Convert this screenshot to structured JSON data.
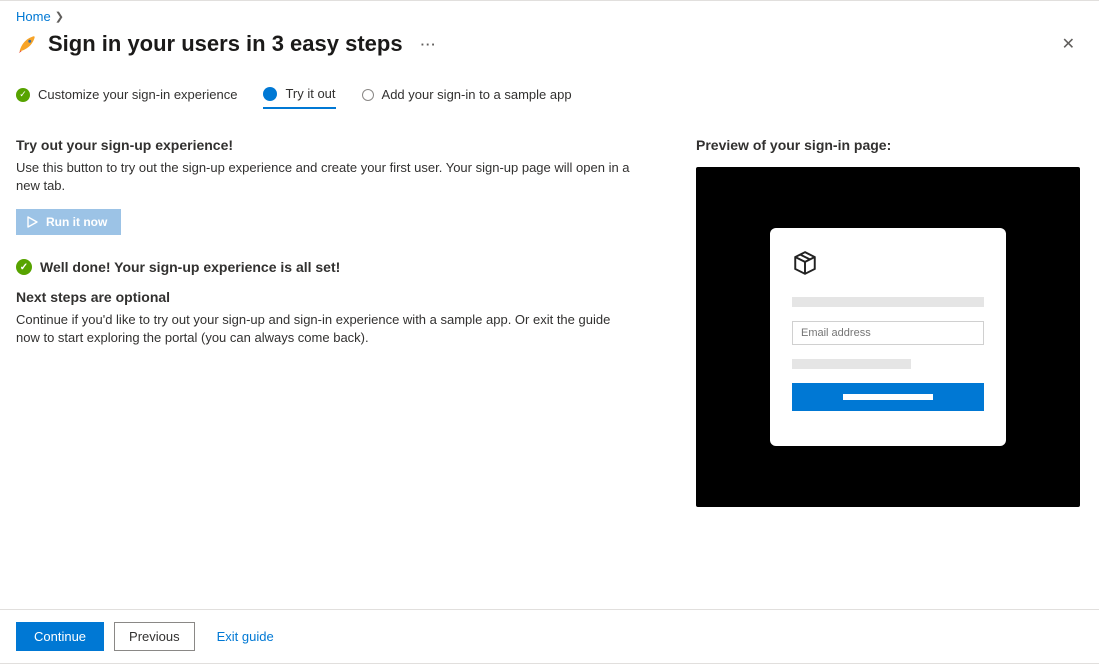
{
  "breadcrumb": {
    "home": "Home"
  },
  "title": "Sign in your users in 3 easy steps",
  "steps": [
    {
      "label": "Customize your sign-in experience",
      "state": "done"
    },
    {
      "label": "Try it out",
      "state": "current"
    },
    {
      "label": "Add your sign-in to a sample app",
      "state": "todo"
    }
  ],
  "left": {
    "heading1": "Try out your sign-up experience!",
    "body1": "Use this button to try out the sign-up experience and create your first user. Your sign-up page will open in a new tab.",
    "run_label": "Run it now",
    "success": "Well done! Your sign-up experience is all set!",
    "heading2": "Next steps are optional",
    "body2": "Continue if you'd like to try out your sign-up and sign-in experience with a sample app. Or exit the guide now to start exploring the portal (you can always come back)."
  },
  "right": {
    "heading": "Preview of your sign-in page:",
    "email_placeholder": "Email address"
  },
  "footer": {
    "continue": "Continue",
    "previous": "Previous",
    "exit": "Exit guide"
  }
}
